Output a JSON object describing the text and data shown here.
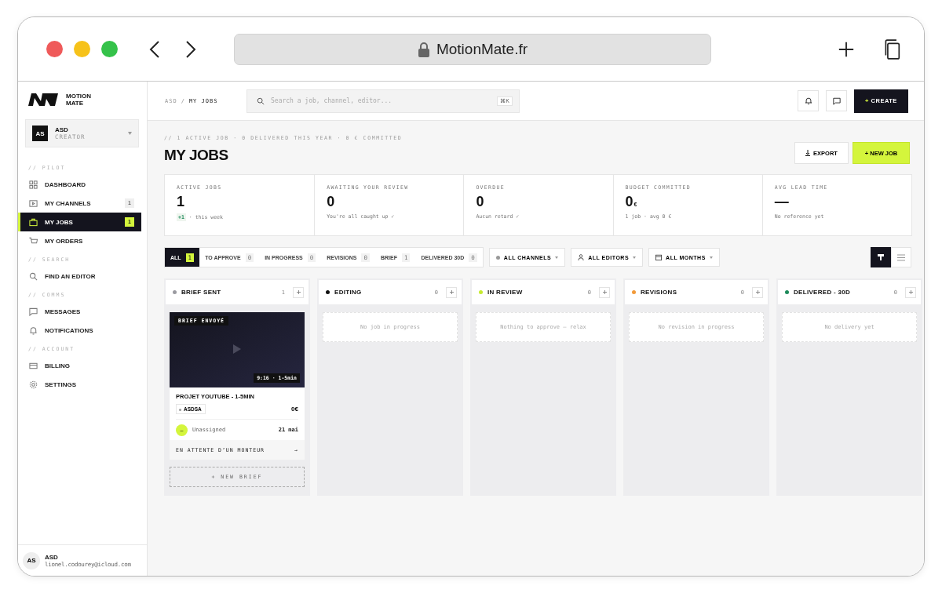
{
  "browser": {
    "url": "MotionMate.fr"
  },
  "sidebar": {
    "logo": [
      "MOTION",
      "MATE"
    ],
    "account": {
      "initials": "AS",
      "name": "ASD",
      "role": "CREATOR"
    },
    "sections": [
      {
        "label": "// PILOT",
        "items": [
          {
            "label": "DASHBOARD",
            "selected": false
          },
          {
            "label": "MY CHANNELS",
            "badge": "1",
            "selected": false
          },
          {
            "label": "MY JOBS",
            "badge": "1",
            "selected": true
          },
          {
            "label": "MY ORDERS",
            "selected": false
          }
        ]
      },
      {
        "label": "// SEARCH",
        "items": [
          {
            "label": "FIND AN EDITOR",
            "selected": false
          }
        ]
      },
      {
        "label": "// COMMS",
        "items": [
          {
            "label": "MESSAGES",
            "selected": false
          },
          {
            "label": "NOTIFICATIONS",
            "selected": false
          }
        ]
      },
      {
        "label": "// ACCOUNT",
        "items": [
          {
            "label": "BILLING",
            "selected": false
          },
          {
            "label": "SETTINGS",
            "selected": false
          }
        ]
      }
    ],
    "user": {
      "initials": "AS",
      "name": "ASD",
      "email": "lionel.codourey@icloud.com"
    }
  },
  "topbar": {
    "breadcrumb": {
      "parent": "ASD",
      "separator": "/",
      "current": "MY JOBS"
    },
    "search": {
      "placeholder": "Search a job, channel, editor...",
      "shortcut": "⌘K"
    },
    "create": {
      "plus": "+",
      "label": "CREATE"
    }
  },
  "page": {
    "summary": "// 1 ACTIVE JOB · 0 DELIVERED THIS YEAR · 0 € COMMITTED",
    "title": "MY JOBS",
    "export": "EXPORT",
    "new_job": "+ NEW JOB"
  },
  "stats": [
    {
      "label": "ACTIVE JOBS",
      "value": "1",
      "delta": "+1",
      "note": "· this week"
    },
    {
      "label": "AWAITING YOUR REVIEW",
      "value": "0",
      "note": "You're all caught up ✓"
    },
    {
      "label": "OVERDUE",
      "value": "0",
      "note": "Aucun retard ✓"
    },
    {
      "label": "BUDGET COMMITTED",
      "value": "0",
      "unit": "€",
      "note": "1 job · avg 0 €"
    },
    {
      "label": "AVG LEAD TIME",
      "value": "—",
      "note": "No reference yet"
    }
  ],
  "filters": {
    "tabs": [
      {
        "label": "ALL",
        "count": "1",
        "selected": true
      },
      {
        "label": "TO APPROVE",
        "count": "0",
        "selected": false
      },
      {
        "label": "IN PROGRESS",
        "count": "0",
        "selected": false
      },
      {
        "label": "REVISIONS",
        "count": "0",
        "selected": false
      },
      {
        "label": "BRIEF",
        "count": "1",
        "selected": false
      },
      {
        "label": "DELIVERED 30D",
        "count": "0",
        "selected": false
      }
    ],
    "dropdowns": [
      {
        "label": "ALL CHANNELS"
      },
      {
        "label": "ALL EDITORS"
      },
      {
        "label": "ALL MONTHS"
      }
    ],
    "views": [
      {
        "kind": "board",
        "selected": true
      },
      {
        "kind": "list",
        "selected": false
      }
    ]
  },
  "columns": [
    {
      "title": "BRIEF SENT",
      "color": "#9a9aa0",
      "count": "1",
      "cards": [
        {
          "tag": "BRIEF ENVOYÉ",
          "duration": "9:16 · 1-5min",
          "title": "PROJET YOUTUBE - 1-5MIN",
          "channel": "ASDSA",
          "price": "0€",
          "avatar": "–",
          "assignee": "Unassigned",
          "date": "21 mai",
          "status": "EN ATTENTE D’UN MONTEUR",
          "arrow": "→"
        }
      ],
      "add": "+ NEW BRIEF"
    },
    {
      "title": "EDITING",
      "color": "#111111",
      "count": "0",
      "empty": "No job in progress"
    },
    {
      "title": "IN REVIEW",
      "color": "#c6ea2f",
      "count": "0",
      "empty": "Nothing to approve — relax"
    },
    {
      "title": "REVISIONS",
      "color": "#f29a3a",
      "count": "0",
      "empty": "No revision in progress"
    },
    {
      "title": "DELIVERED - 30D",
      "color": "#1d8a5a",
      "count": "0",
      "empty": "No delivery yet"
    }
  ]
}
